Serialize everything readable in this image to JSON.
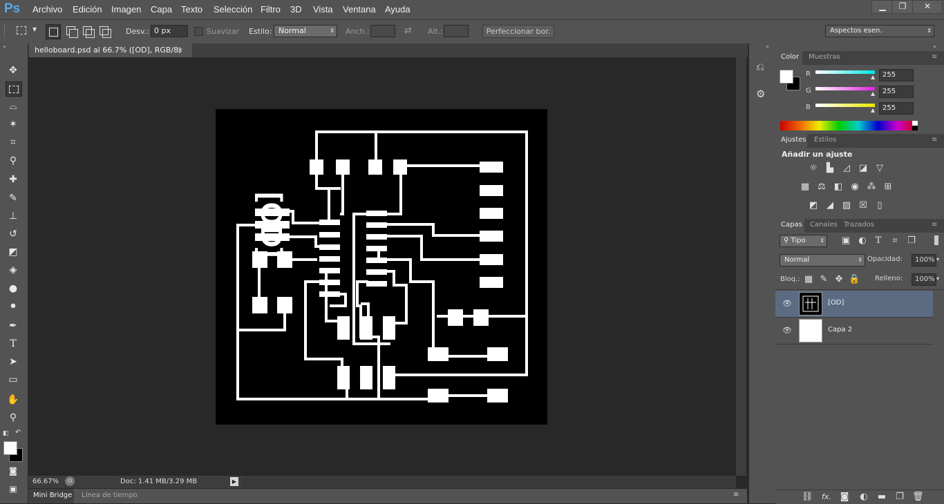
{
  "app": {
    "logo": "Ps"
  },
  "menu": [
    "Archivo",
    "Edición",
    "Imagen",
    "Capa",
    "Texto",
    "Selección",
    "Filtro",
    "3D",
    "Vista",
    "Ventana",
    "Ayuda"
  ],
  "window_controls": {
    "minimize": "▁",
    "restore": "❐",
    "close": "✕"
  },
  "options": {
    "desv_label": "Desv.:",
    "desv_value": "0 px",
    "suavizar_label": "Suavizar",
    "estilo_label": "Estilo:",
    "estilo_value": "Normal",
    "anch_label": "Anch.:",
    "alt_label": "Alt.:",
    "refine_button": "Perfeccionar bor.",
    "workspace": "Aspectos esen."
  },
  "document": {
    "tab_title": "helloboard.psd al 66.7% ([OD], RGB/8)",
    "close": "×",
    "logo_text": "[OD]"
  },
  "status": {
    "zoom": "66.67%",
    "doc_info": "Doc: 1.41 MB/3.29 MB"
  },
  "bottom_tabs": [
    "Mini Bridge",
    "Línea de tiempo"
  ],
  "color_panel": {
    "tabs": [
      "Color",
      "Muestras"
    ],
    "channels": [
      {
        "label": "R",
        "value": "255",
        "color": "#00e5e5"
      },
      {
        "label": "G",
        "value": "255",
        "color": "#e020e0"
      },
      {
        "label": "B",
        "value": "255",
        "color": "#e8e800"
      }
    ]
  },
  "adjust_panel": {
    "tabs": [
      "Ajustes",
      "Estilos"
    ],
    "heading": "Añadir un ajuste"
  },
  "layers_panel": {
    "tabs": [
      "Capas",
      "Canales",
      "Trazados"
    ],
    "filter": "Tipo",
    "blend": "Normal",
    "opacity_label": "Opacidad:",
    "opacity_value": "100%",
    "lock_label": "Bloq.:",
    "fill_label": "Relleno:",
    "fill_value": "100%",
    "layers": [
      {
        "name": "[OD]",
        "selected": true
      },
      {
        "name": "Capa 2",
        "selected": false
      }
    ],
    "footer_fx": "fx."
  },
  "icons": [
    "move-icon",
    "marquee-icon",
    "lasso-icon",
    "magic-wand-icon",
    "crop-icon",
    "eyedropper-icon",
    "healing-icon",
    "brush-icon",
    "stamp-icon",
    "history-brush-icon",
    "eraser-icon",
    "paint-bucket-icon",
    "blur-icon",
    "dodge-icon",
    "pen-icon",
    "type-icon",
    "path-select-icon",
    "rectangle-icon",
    "hand-icon",
    "zoom-icon"
  ]
}
